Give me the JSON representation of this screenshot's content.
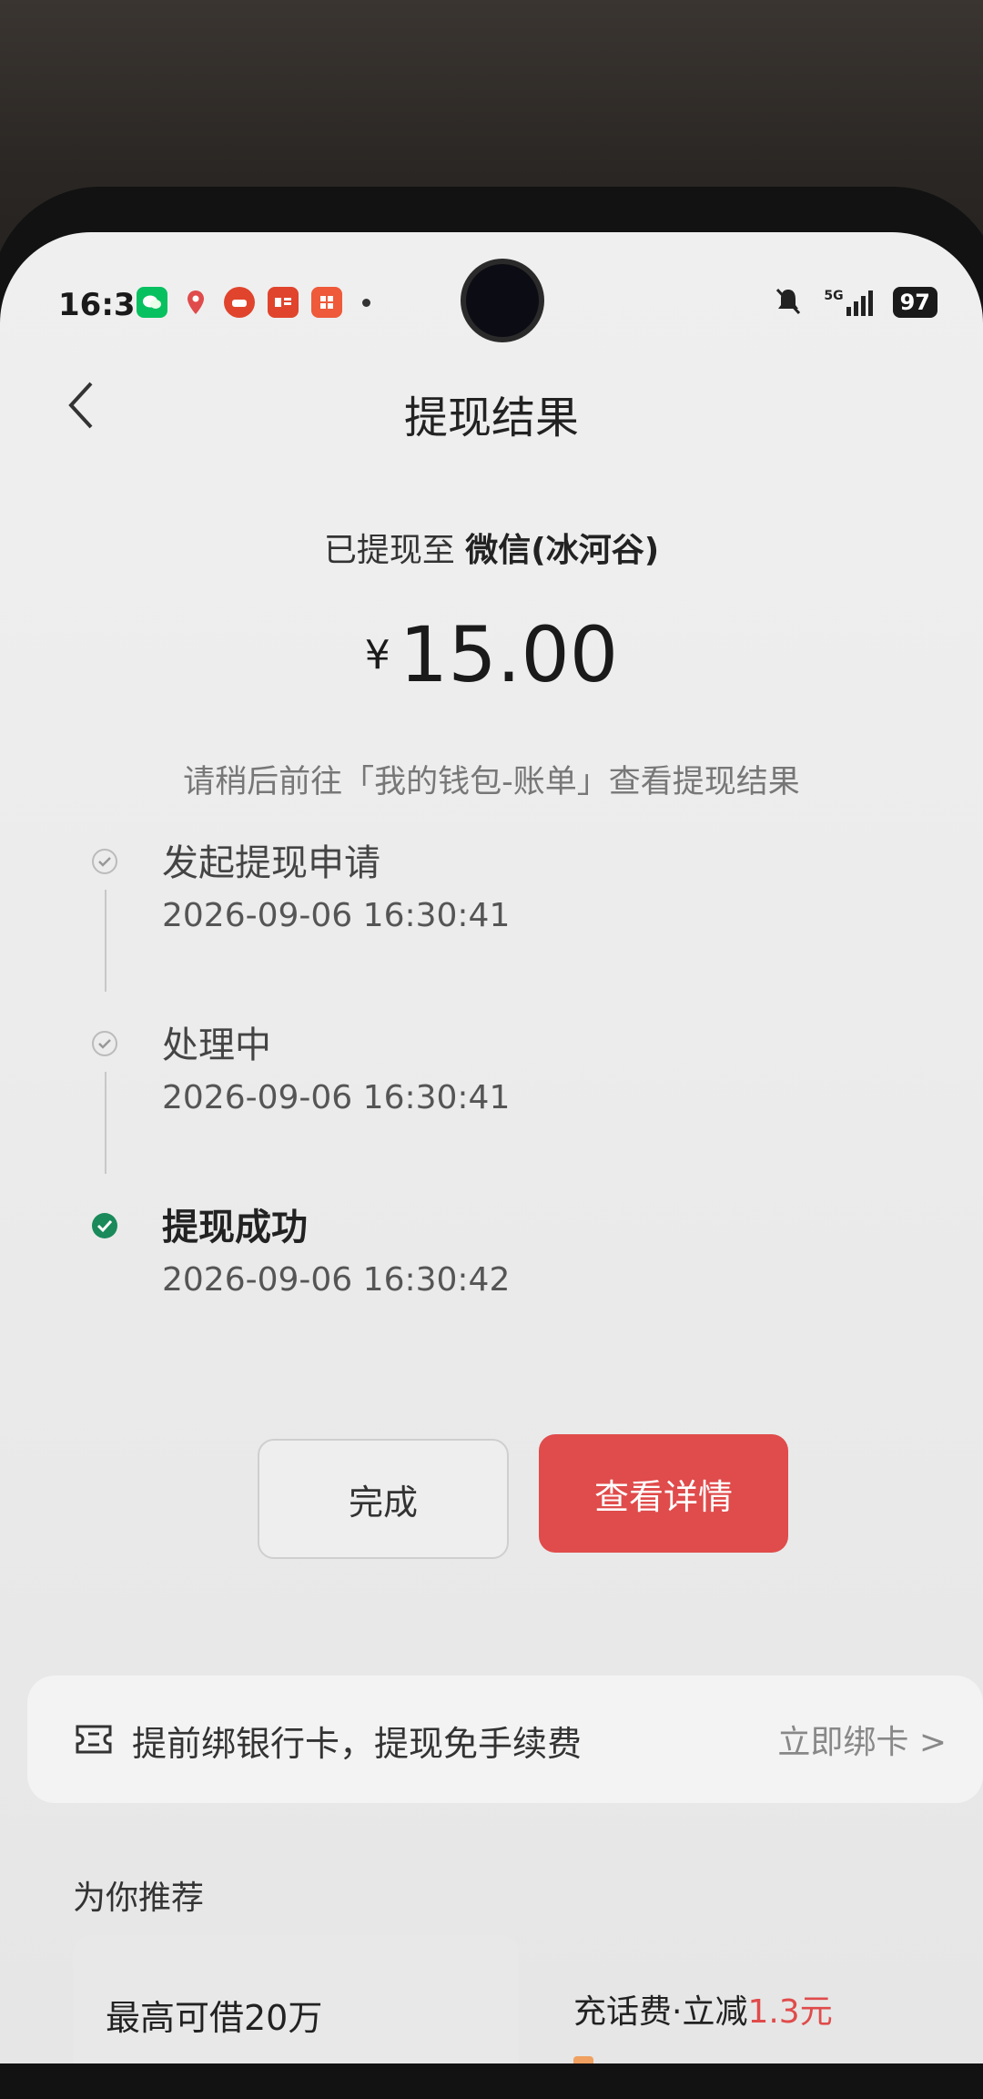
{
  "status_bar": {
    "time": "16:30",
    "apps": [
      {
        "icon": "wechat-icon",
        "color": "#07c160",
        "text": ""
      },
      {
        "icon": "location-icon",
        "color": "#e04b4b",
        "text": ""
      },
      {
        "icon": "taobao-icon",
        "color": "#e0442c",
        "text": ""
      },
      {
        "icon": "news-icon",
        "color": "#e0442c",
        "text": ""
      },
      {
        "icon": "app-icon",
        "color": "#ee5a3a",
        "text": ""
      }
    ],
    "network": "5G",
    "battery": "97"
  },
  "nav": {
    "title": "提现结果"
  },
  "result": {
    "dest_prefix": "已提现至 ",
    "dest_name": "微信(冰河谷)",
    "currency": "¥",
    "amount": "15.00",
    "hint": "请稍后前往「我的钱包-账单」查看提现结果"
  },
  "timeline": [
    {
      "title": "发起提现申请",
      "time": "2026-09-06 16:30:41",
      "status": "done"
    },
    {
      "title": "处理中",
      "time": "2026-09-06 16:30:41",
      "status": "done"
    },
    {
      "title": "提现成功",
      "time": "2026-09-06 16:30:42",
      "status": "success"
    }
  ],
  "actions": {
    "done_label": "完成",
    "detail_label": "查看详情"
  },
  "bind_card": {
    "text": "提前绑银行卡，提现免手续费",
    "link": "立即绑卡 >"
  },
  "recommend": {
    "title": "为你推荐",
    "left": "最高可借20万",
    "right_prefix": "充话费·立减",
    "right_highlight": "1.3元"
  },
  "colors": {
    "accent_red": "#e04b4b",
    "success_green": "#1a8a5a"
  }
}
